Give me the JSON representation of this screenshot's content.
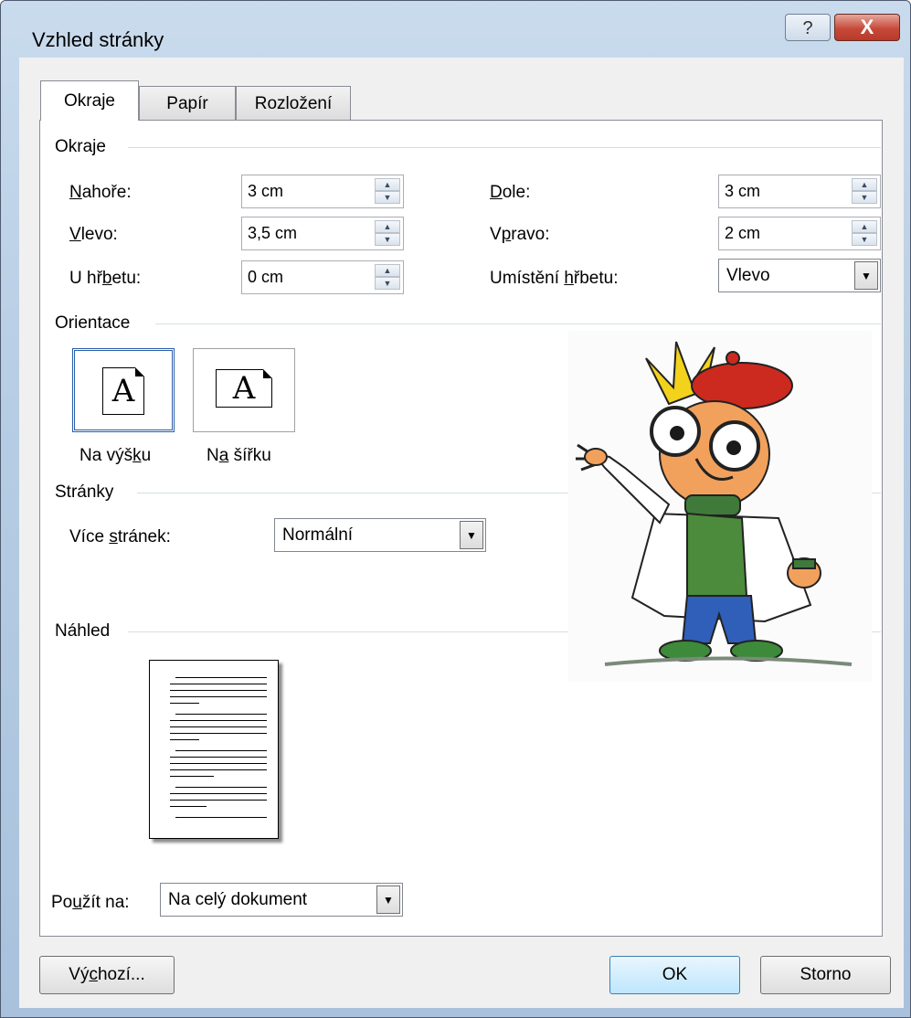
{
  "window": {
    "title": "Vzhled stránky",
    "help": "?",
    "close": "X"
  },
  "tabs": [
    {
      "label": "Okraje"
    },
    {
      "label": "Papír"
    },
    {
      "label": "Rozložení"
    }
  ],
  "margins": {
    "group": "Okraje",
    "top_label": "Nahoře:",
    "top_value": "3 cm",
    "bottom_label": "Dole:",
    "bottom_value": "3 cm",
    "left_label": "Vlevo:",
    "left_value": "3,5 cm",
    "right_label": "Vpravo:",
    "right_value": "2 cm",
    "gutter_label": "U hřbetu:",
    "gutter_value": "0 cm",
    "gutter_pos_label": "Umístění hřbetu:",
    "gutter_pos_value": "Vlevo"
  },
  "orientation": {
    "group": "Orientace",
    "glyph": "A",
    "portrait": "Na výšku",
    "landscape": "Na šířku"
  },
  "pages": {
    "group": "Stránky",
    "multiple_label": "Více stránek:",
    "multiple_value": "Normální"
  },
  "preview": {
    "group": "Náhled"
  },
  "apply": {
    "label": "Použít na:",
    "value": "Na celý dokument"
  },
  "buttons": {
    "default": "Výchozí...",
    "ok": "OK",
    "cancel": "Storno"
  }
}
